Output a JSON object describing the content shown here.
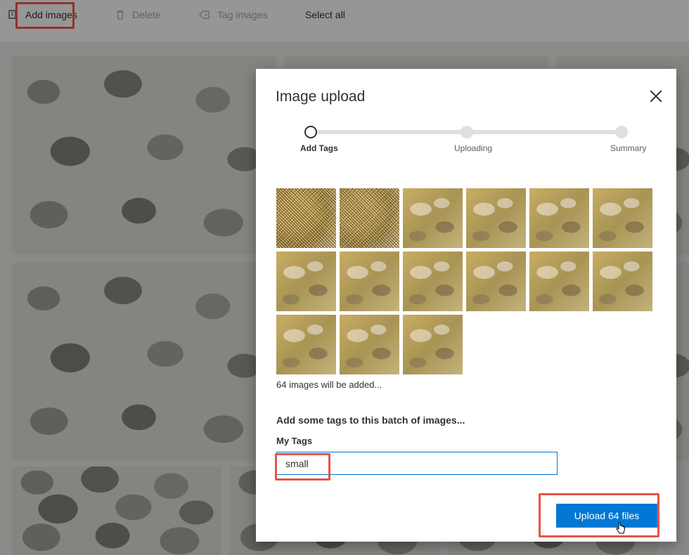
{
  "toolbar": {
    "add_images": "Add images",
    "delete": "Delete",
    "tag_images": "Tag images",
    "select_all": "Select all"
  },
  "dialog": {
    "title": "Image upload",
    "steps": [
      {
        "label": "Add Tags",
        "state": "active"
      },
      {
        "label": "Uploading",
        "state": "pending"
      },
      {
        "label": "Summary",
        "state": "pending"
      }
    ],
    "thumbnail_count_shown": 15,
    "images_note": "64 images will be added...",
    "tags_heading": "Add some tags to this batch of images...",
    "my_tags_label": "My Tags",
    "tag_input_value": "small",
    "upload_button": "Upload 64 files"
  },
  "colors": {
    "accent": "#0078d4",
    "highlight": "#e8534a"
  },
  "icons": {
    "add_images": "add-image-icon",
    "delete": "trash-icon",
    "tag_images": "tag-icon",
    "close": "close-icon",
    "cursor": "hand-pointer-icon"
  }
}
